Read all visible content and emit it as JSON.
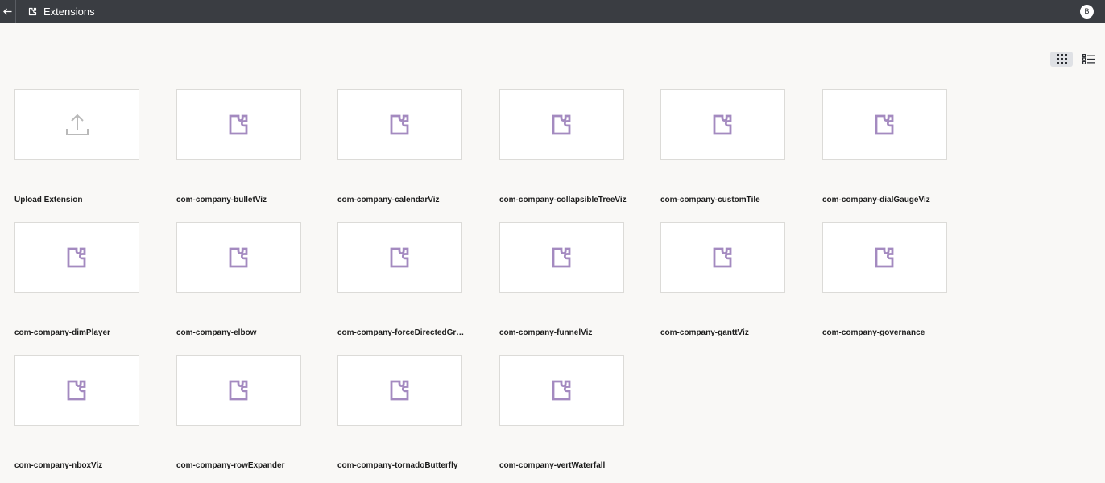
{
  "header": {
    "title": "Extensions",
    "avatar_initial": "B"
  },
  "cards": [
    {
      "label": "Upload Extension",
      "icon": "upload-icon"
    },
    {
      "label": "com-company-bulletViz",
      "icon": "puzzle-icon"
    },
    {
      "label": "com-company-calendarViz",
      "icon": "puzzle-icon"
    },
    {
      "label": "com-company-collapsibleTreeViz",
      "icon": "puzzle-icon"
    },
    {
      "label": "com-company-customTile",
      "icon": "puzzle-icon"
    },
    {
      "label": "com-company-dialGaugeViz",
      "icon": "puzzle-icon"
    },
    {
      "label": "com-company-dimPlayer",
      "icon": "puzzle-icon"
    },
    {
      "label": "com-company-elbow",
      "icon": "puzzle-icon"
    },
    {
      "label": "com-company-forceDirectedGra...",
      "icon": "puzzle-icon"
    },
    {
      "label": "com-company-funnelViz",
      "icon": "puzzle-icon"
    },
    {
      "label": "com-company-ganttViz",
      "icon": "puzzle-icon"
    },
    {
      "label": "com-company-governance",
      "icon": "puzzle-icon"
    },
    {
      "label": "com-company-nboxViz",
      "icon": "puzzle-icon"
    },
    {
      "label": "com-company-rowExpander",
      "icon": "puzzle-icon"
    },
    {
      "label": "com-company-tornadoButterfly",
      "icon": "puzzle-icon"
    },
    {
      "label": "com-company-vertWaterfall",
      "icon": "puzzle-icon"
    }
  ],
  "colors": {
    "header_bg": "#3a3d42",
    "page_bg": "#f9f8f6",
    "puzzle_icon": "#a48ac0",
    "upload_icon": "#b9b9b9"
  }
}
